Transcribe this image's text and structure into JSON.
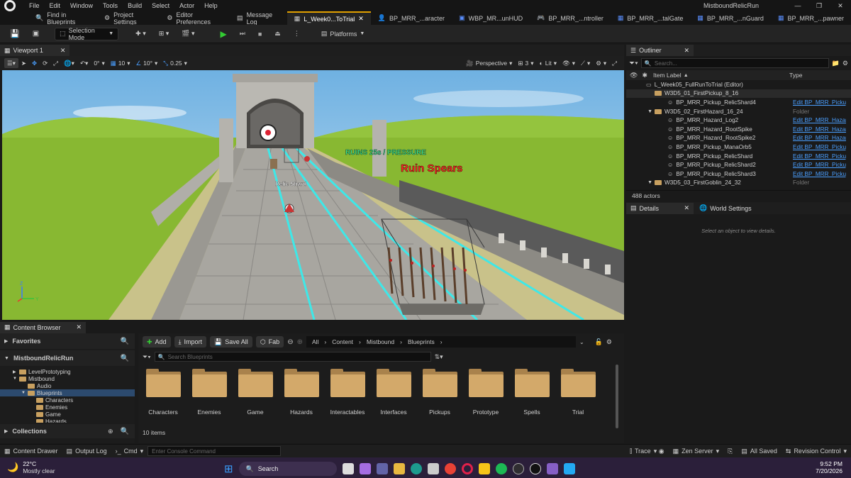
{
  "menubar": {
    "items": [
      "File",
      "Edit",
      "Window",
      "Tools",
      "Build",
      "Select",
      "Actor",
      "Help"
    ],
    "project_name": "MistboundRelicRun"
  },
  "tabs": [
    {
      "label": "Find in Blueprints"
    },
    {
      "label": "Project Settings"
    },
    {
      "label": "Editor Preferences"
    },
    {
      "label": "Message Log"
    },
    {
      "label": "L_Week0...ToTrial"
    },
    {
      "label": "BP_MRR_...aracter"
    },
    {
      "label": "WBP_MR...unHUD"
    },
    {
      "label": "BP_MRR_...ntroller"
    },
    {
      "label": "BP_MRR_...talGate"
    },
    {
      "label": "BP_MRR_...nGuard"
    },
    {
      "label": "BP_MRR_...pawner"
    }
  ],
  "toolbar": {
    "selection_mode": "Selection Mode",
    "platforms": "Platforms"
  },
  "viewport": {
    "tab_label": "Viewport 1",
    "perspective": "Perspective",
    "lit": "Lit",
    "camera_speed": "3",
    "grid_snap": "10",
    "rot_snap": "10°",
    "scale_snap": "0.25",
    "angle": "0°",
    "scene": {
      "hud_text": "RUINS 25s / PRESSURE",
      "hazard_label": "Ruin Spears",
      "pickup_label": "Relic Shard"
    }
  },
  "outliner": {
    "title": "Outliner",
    "search_placeholder": "Search...",
    "col_label": "Item Label",
    "col_type": "Type",
    "rows": [
      {
        "label": "L_Week05_FullRunToTrial (Editor)",
        "type": ""
      },
      {
        "label": "W3D5_01_FirstPickup_8_16",
        "type": ""
      },
      {
        "label": "BP_MRR_Pickup_RelicShard4",
        "type": "Edit BP_MRR_Pickup"
      },
      {
        "label": "W3D5_02_FirstHazard_16_24",
        "type": "Folder"
      },
      {
        "label": "BP_MRR_Hazard_Log2",
        "type": "Edit BP_MRR_Hazard"
      },
      {
        "label": "BP_MRR_Hazard_RootSpike",
        "type": "Edit BP_MRR_Hazard"
      },
      {
        "label": "BP_MRR_Hazard_RootSpike2",
        "type": "Edit BP_MRR_Hazard"
      },
      {
        "label": "BP_MRR_Pickup_ManaOrb5",
        "type": "Edit BP_MRR_Pickup"
      },
      {
        "label": "BP_MRR_Pickup_RelicShard",
        "type": "Edit BP_MRR_Pickup"
      },
      {
        "label": "BP_MRR_Pickup_RelicShard2",
        "type": "Edit BP_MRR_Pickup"
      },
      {
        "label": "BP_MRR_Pickup_RelicShard3",
        "type": "Edit BP_MRR_Pickup"
      },
      {
        "label": "W3D5_03_FirstGoblin_24_32",
        "type": "Folder"
      }
    ],
    "actor_count": "488 actors"
  },
  "details": {
    "tab_label": "Details",
    "world_settings_label": "World Settings",
    "empty_hint": "Select an object to view details."
  },
  "content_browser": {
    "tab_label": "Content Browser",
    "favorites": "Favorites",
    "project_root": "MistboundRelicRun",
    "tree": [
      {
        "label": "LevelPrototyping",
        "depth": 1
      },
      {
        "label": "Mistbound",
        "depth": 1
      },
      {
        "label": "Audio",
        "depth": 2
      },
      {
        "label": "Blueprints",
        "depth": 2
      },
      {
        "label": "Characters",
        "depth": 3
      },
      {
        "label": "Enemies",
        "depth": 3
      },
      {
        "label": "Game",
        "depth": 3
      },
      {
        "label": "Hazards",
        "depth": 3
      }
    ],
    "collections": "Collections",
    "add": "Add",
    "import": "Import",
    "save_all": "Save All",
    "fab": "Fab",
    "breadcrumb": [
      "All",
      "Content",
      "Mistbound",
      "Blueprints"
    ],
    "search_placeholder": "Search Blueprints",
    "folders": [
      "Characters",
      "Enemies",
      "Game",
      "Hazards",
      "Interactables",
      "Interfaces",
      "Pickups",
      "Prototype",
      "Spells",
      "Trial"
    ],
    "item_count": "10 items"
  },
  "statusbar": {
    "content_drawer": "Content Drawer",
    "output_log": "Output Log",
    "cmd": "Cmd",
    "console_placeholder": "Enter Console Command",
    "trace": "Trace",
    "zen_server": "Zen Server",
    "all_saved": "All Saved",
    "revision_control": "Revision Control"
  },
  "taskbar": {
    "weather_temp": "22°C",
    "weather_desc": "Mostly clear",
    "search": "Search",
    "time": "9:52 PM",
    "date": "7/20/2026"
  }
}
